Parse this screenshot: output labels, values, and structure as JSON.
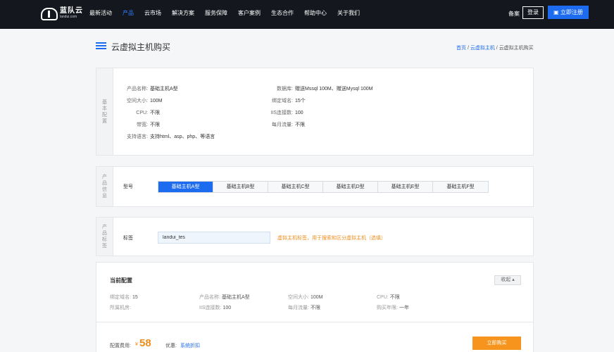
{
  "brand": {
    "name_cn": "蓝队云",
    "name_en": "landui.com"
  },
  "nav": [
    "最新活动",
    "产品",
    "云市场",
    "解决方案",
    "服务保障",
    "客户案例",
    "生态合作",
    "帮助中心",
    "关于我们"
  ],
  "nav_active_index": 1,
  "top_right": {
    "beian": "备案",
    "login": "登录",
    "register": "立即注册"
  },
  "page": {
    "title": "云虚拟主机购买",
    "breadcrumb": {
      "home": "首页",
      "sep": " / ",
      "parent": "云虚拟主机",
      "current": "云虚拟主机购买"
    }
  },
  "basic": {
    "side_label": "基本配置",
    "left": [
      {
        "k": "产品名称:",
        "v": "基础主机A型"
      },
      {
        "k": "空间大小:",
        "v": "100M"
      },
      {
        "k": "CPU:",
        "v": "不限"
      },
      {
        "k": "带宽:",
        "v": "不限"
      },
      {
        "k": "支持语言:",
        "v": "支持html、asp、php、等语言"
      }
    ],
    "right": [
      {
        "k": "数据库:",
        "v": "赠送Mssql 100M、赠送Mysql 100M"
      },
      {
        "k": "绑定域名:",
        "v": "15个"
      },
      {
        "k": "IIS连接数:",
        "v": "100"
      },
      {
        "k": "每月流量:",
        "v": "不限"
      }
    ]
  },
  "product_info": {
    "side_label": "产品信息",
    "type_label": "型号",
    "types": [
      "基础主机A型",
      "基础主机B型",
      "基础主机C型",
      "基础主机D型",
      "基础主机E型",
      "基础主机F型"
    ],
    "active_index": 0
  },
  "product_tag": {
    "side_label": "产品标签",
    "label": "标签",
    "value": "landui_tes",
    "hint": "虚拟主机标签，用于搜索和区分虚拟主机（选填）"
  },
  "current": {
    "title": "当前配置",
    "collapse": "收起",
    "collapse_icon": "caret-up-icon",
    "items": [
      {
        "k": "绑定域名:",
        "v": "15"
      },
      {
        "k": "产品名称:",
        "v": "基础主机A型"
      },
      {
        "k": "空间大小:",
        "v": "100M"
      },
      {
        "k": "CPU:",
        "v": "不限"
      },
      {
        "k": "所属机房:",
        "v": ""
      },
      {
        "k": "IIS连接数:",
        "v": "100"
      },
      {
        "k": "每月流量:",
        "v": "不限"
      },
      {
        "k": "购买年限:",
        "v": "一年"
      }
    ],
    "price_label": "配置费用:",
    "currency": "¥",
    "price": "58",
    "promo_label": "优惠:",
    "promo_link": "系统折扣",
    "buy": "立即购买"
  },
  "colors": {
    "accent": "#1d6cf0",
    "orange": "#f7941d",
    "nav_bg": "#14171d"
  }
}
